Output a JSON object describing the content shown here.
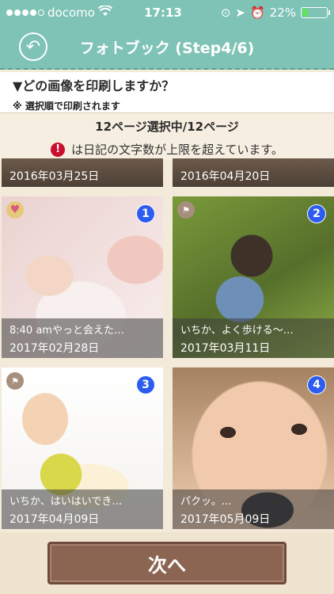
{
  "status_bar": {
    "carrier": "docomo",
    "time": "17:13",
    "battery_percent": "22%",
    "battery_level": 0.22
  },
  "header": {
    "title": "フォトブック (Step4/6)",
    "back_icon": "back-arrow-icon"
  },
  "question": {
    "main": "▼どの画像を印刷しますか？",
    "sub": "※ 選択順で印刷されます"
  },
  "info": {
    "count": "12ページ選択中/12ページ",
    "warning_icon": "!",
    "warning": "は日記の文字数が上限を超えています。"
  },
  "previous_row": [
    {
      "date": "2016年03月25日"
    },
    {
      "date": "2016年04月20日"
    }
  ],
  "tiles": [
    {
      "badge": "1",
      "caption": "8:40 amやっと会えた…",
      "date": "2017年02月28日",
      "mark": "heart-icon"
    },
    {
      "badge": "2",
      "caption": "いちか、よく歩ける〜…",
      "date": "2017年03月11日",
      "mark": "flag-icon"
    },
    {
      "badge": "3",
      "caption": "いちか、はいはいでき…",
      "date": "2017年04月09日",
      "mark": "flag-icon"
    },
    {
      "badge": "4",
      "caption": "パクッ。...",
      "date": "2017年05月09日",
      "mark": ""
    }
  ],
  "next_button": "次へ"
}
